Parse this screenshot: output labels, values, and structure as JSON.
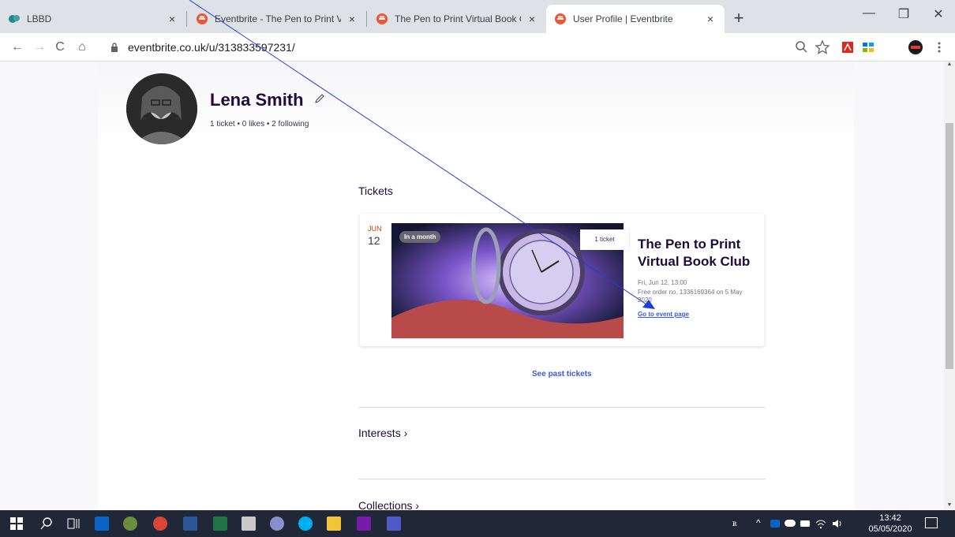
{
  "browser": {
    "tabs": [
      {
        "label": "LBBD",
        "active": false
      },
      {
        "label": "Eventbrite - The Pen to Print Virtu",
        "active": false
      },
      {
        "label": "The Pen to Print Virtual Book Clu",
        "active": false
      },
      {
        "label": "User Profile | Eventbrite",
        "active": true
      }
    ],
    "close_glyph": "×",
    "new_tab_glyph": "+",
    "window_controls": {
      "minimize": "—",
      "restore": "❐",
      "close": "✕"
    },
    "url": "eventbrite.co.uk/u/313833597231/",
    "nav": {
      "back": "←",
      "forward": "→",
      "reload": "C",
      "home": "⌂"
    }
  },
  "profile": {
    "name": "Lena Smith",
    "stats": "1 ticket  •  0 likes  •  2 following"
  },
  "tickets": {
    "heading": "Tickets",
    "items": [
      {
        "month": "JUN",
        "day": "12",
        "status_pill": "In a month",
        "ticket_count": "1 ticket",
        "title": "The Pen to Print Virtual Book Club",
        "when": "Fri, Jun 12, 13:00",
        "order_info": "Free order no. 1336169364 on 5 May 2020",
        "link_label": "Go to event page"
      }
    ],
    "see_past_label": "See past tickets"
  },
  "sections": {
    "interests": "Interests ›",
    "collections": "Collections ›"
  },
  "taskbar": {
    "time": "13:42",
    "date": "05/05/2020"
  },
  "colors": {
    "accent_link": "#3659e3",
    "date_month": "#d1410c",
    "heading": "#1e0a3c",
    "annotation_line": "#1b3fd6"
  }
}
